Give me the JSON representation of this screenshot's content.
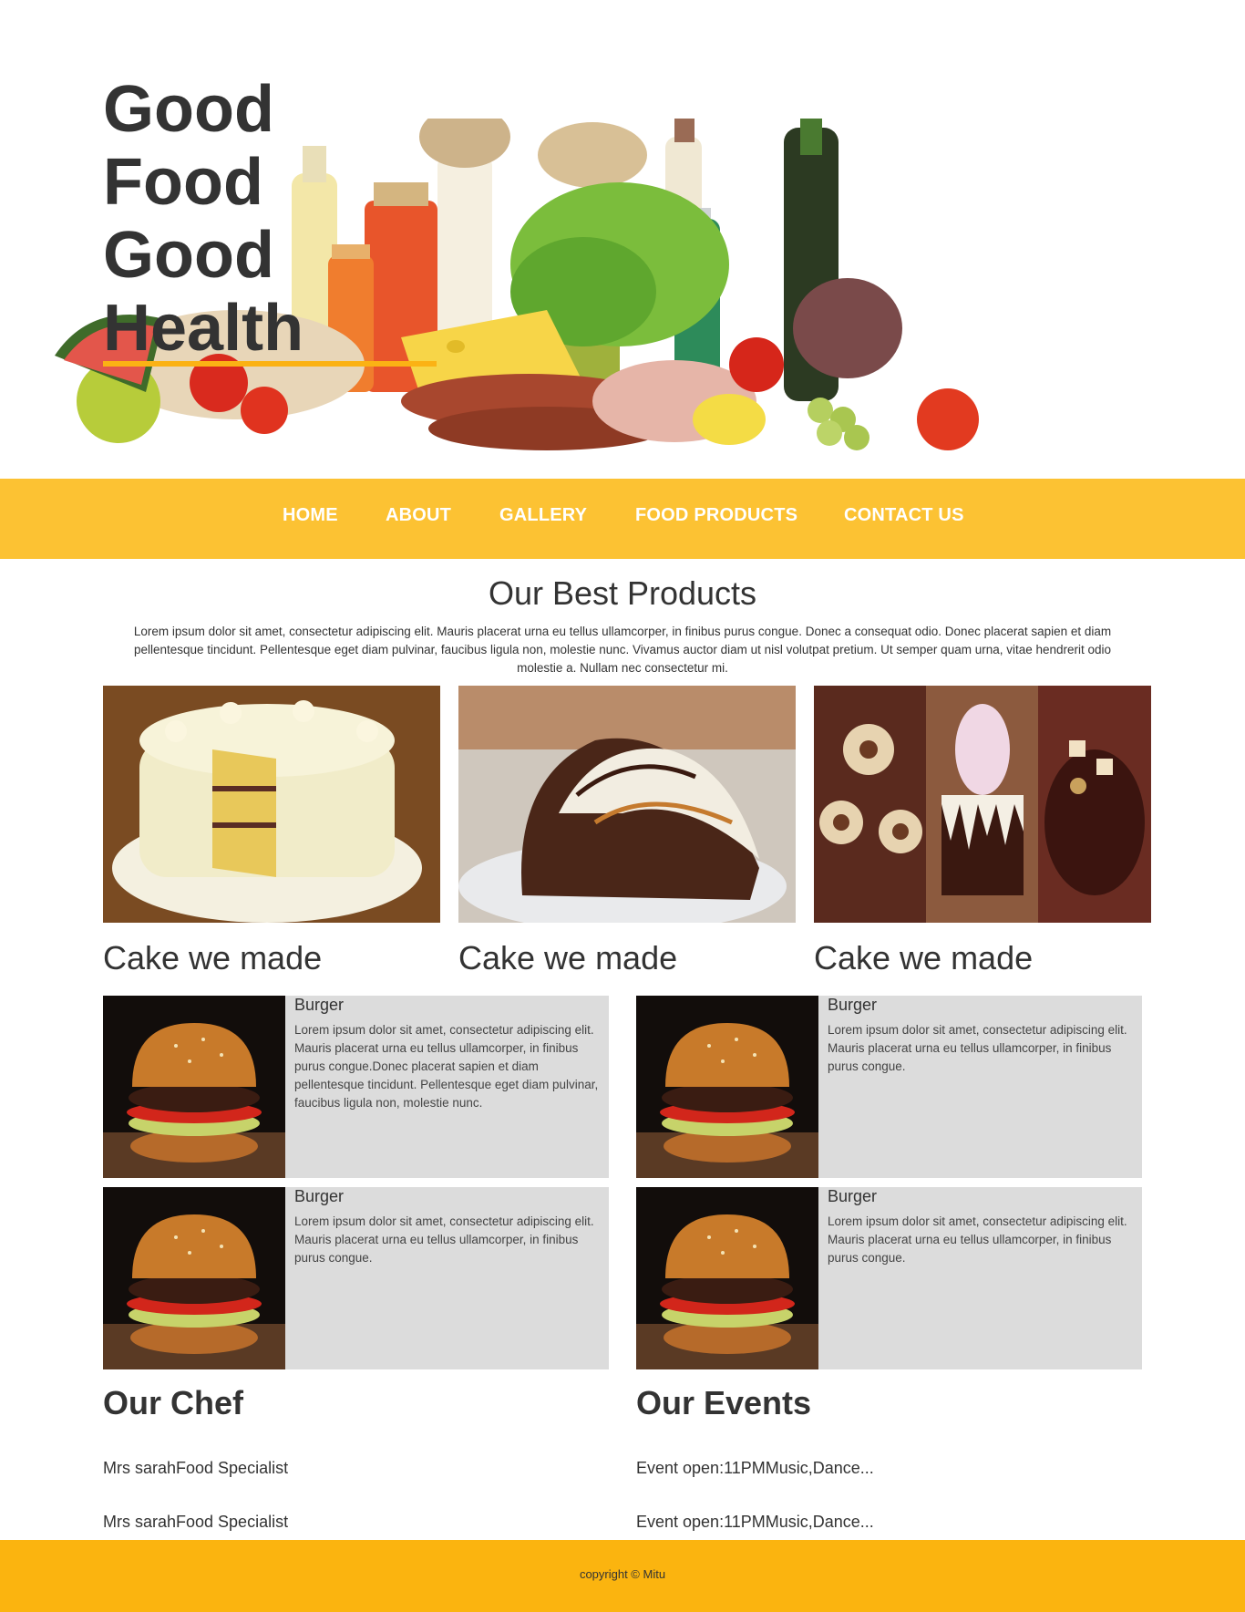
{
  "hero": {
    "title_lines": [
      "Good",
      "Food",
      "Good",
      "Health"
    ]
  },
  "nav": {
    "items": [
      {
        "label": "HOME"
      },
      {
        "label": "ABOUT"
      },
      {
        "label": "GALLERY"
      },
      {
        "label": "FOOD PRODUCTS"
      },
      {
        "label": "CONTACT US"
      }
    ]
  },
  "products": {
    "title": "Our Best Products",
    "intro": "Lorem ipsum dolor sit amet, consectetur adipiscing elit. Mauris placerat urna eu tellus ullamcorper, in finibus purus congue. Donec a consequat odio. Donec placerat sapien et diam pellentesque tincidunt. Pellentesque eget diam pulvinar, faucibus ligula non, molestie nunc. Vivamus auctor diam ut nisl volutpat pretium. Ut semper quam urna, vitae hendrerit odio molestie a. Nullam nec consectetur mi.",
    "cards": [
      {
        "title": "Cake we made"
      },
      {
        "title": "Cake we made"
      },
      {
        "title": "Cake we made"
      }
    ]
  },
  "burgers": [
    {
      "name": "Burger",
      "desc": "Lorem ipsum dolor sit amet, consectetur adipiscing elit. Mauris placerat urna eu tellus ullamcorper, in finibus purus congue.Donec placerat sapien et diam pellentesque tincidunt. Pellentesque eget diam pulvinar, faucibus ligula non, molestie nunc."
    },
    {
      "name": "Burger",
      "desc": "Lorem ipsum dolor sit amet, consectetur adipiscing elit. Mauris placerat urna eu tellus ullamcorper, in finibus purus congue."
    },
    {
      "name": "Burger",
      "desc": "Lorem ipsum dolor sit amet, consectetur adipiscing elit. Mauris placerat urna eu tellus ullamcorper, in finibus purus congue."
    },
    {
      "name": "Burger",
      "desc": "Lorem ipsum dolor sit amet, consectetur adipiscing elit. Mauris placerat urna eu tellus ullamcorper, in finibus purus congue."
    }
  ],
  "chef": {
    "title": "Our Chef",
    "items": [
      "Mrs sarahFood Specialist",
      "Mrs sarahFood Specialist"
    ]
  },
  "events": {
    "title": "Our Events",
    "items": [
      "Event open:11PMMusic,Dance...",
      "Event open:11PMMusic,Dance..."
    ]
  },
  "footer": {
    "copyright": "copyright © Mitu"
  },
  "colors": {
    "accent": "#fbb214",
    "nav_bg": "#fcb917",
    "footer_bg": "#fbb40f",
    "card_bg": "#dcdcdc",
    "text": "#333333"
  }
}
